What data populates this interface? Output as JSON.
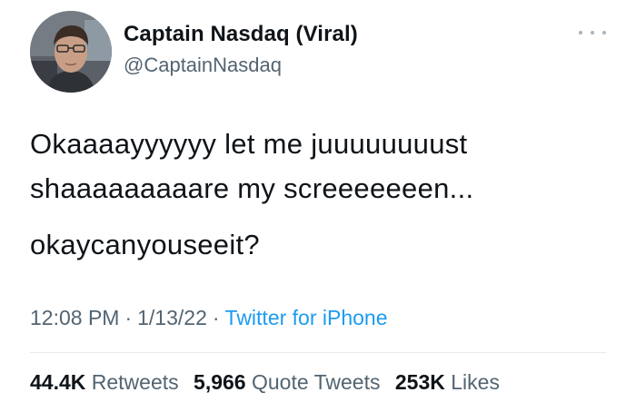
{
  "user": {
    "display_name": "Captain Nasdaq (Viral)",
    "handle": "@CaptainNasdaq"
  },
  "tweet": {
    "lines": [
      "Okaaaayyyyyy let me juuuuuuuust",
      "shaaaaaaaaare my screeeeeeen...",
      "okaycanyouseeit?"
    ]
  },
  "meta": {
    "time": "12:08 PM",
    "separator": "·",
    "date": "1/13/22",
    "source": "Twitter for iPhone"
  },
  "stats": {
    "retweets_count": "44.4K",
    "retweets_label": "Retweets",
    "quotes_count": "5,966",
    "quotes_label": "Quote Tweets",
    "likes_count": "253K",
    "likes_label": "Likes"
  },
  "colors": {
    "text": "#0f1419",
    "secondary": "#536471",
    "link": "#1d9bf0",
    "divider": "#e7e9ea"
  },
  "icons": {
    "more": "more-horizontal-icon"
  }
}
